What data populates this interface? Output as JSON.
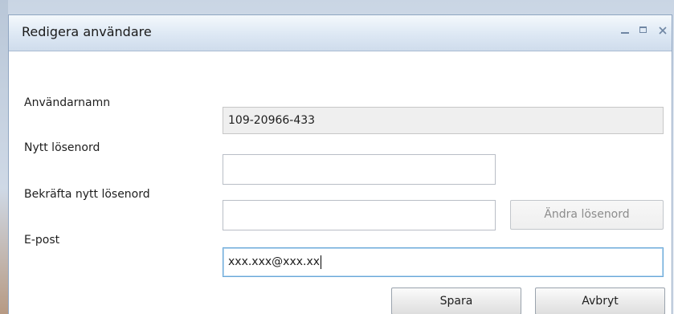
{
  "window": {
    "title": "Redigera användare"
  },
  "form": {
    "username_label": "Användarnamn",
    "username_value": "109-20966-433",
    "new_password_label": "Nytt lösenord",
    "new_password_value": "",
    "confirm_password_label": "Bekräfta nytt lösenord",
    "confirm_password_value": "",
    "change_password_button": "Ändra lösenord",
    "email_label": "E-post",
    "email_value": "xxx.xxx@xxx.xx"
  },
  "actions": {
    "save_label": "Spara",
    "cancel_label": "Avbryt"
  },
  "icons": {
    "minimize": "minimize-icon",
    "maximize": "maximize-icon",
    "close": "close-icon"
  },
  "colors": {
    "focus_border": "#6aa8d8",
    "titlebar": "#dde8f4"
  }
}
